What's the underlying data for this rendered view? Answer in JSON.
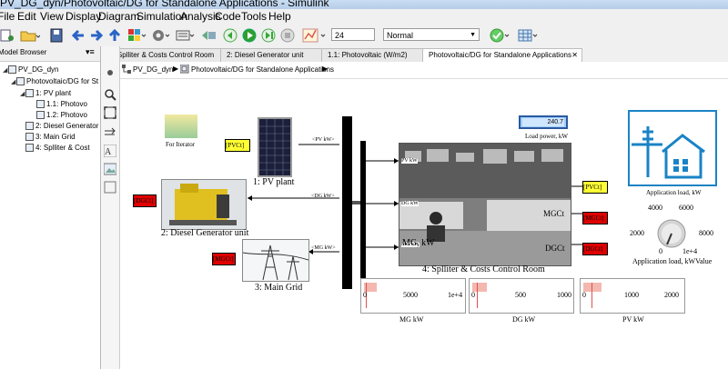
{
  "window_title": "PV_DG_dyn/Photovoltaic/DG for Standalone Applications - Simulink",
  "menu": [
    "File",
    "Edit",
    "View",
    "Display",
    "Diagram",
    "Simulation",
    "Analysis",
    "Code",
    "Tools",
    "Help"
  ],
  "toolbar": {
    "stop_time": "24",
    "sim_mode": "Normal"
  },
  "browser": {
    "title": "Model Browser",
    "items": [
      {
        "label": "PV_DG_dyn"
      },
      {
        "label": "Photovoltaic/DG for St"
      },
      {
        "label": "1: PV plant"
      },
      {
        "label": "1.1: Photovo"
      },
      {
        "label": "1.2: Photovo"
      },
      {
        "label": "2: Diesel Generator"
      },
      {
        "label": "3: Main Grid"
      },
      {
        "label": "4: Splliter & Cost"
      }
    ]
  },
  "tabs": [
    {
      "label": "4: Splliter & Costs Control Room"
    },
    {
      "label": "2: Diesel Generator unit"
    },
    {
      "label": "1.1: Photovoltaic (W/m2)"
    },
    {
      "label": "Photovoltaic/DG for Standalone Applications"
    }
  ],
  "breadcrumb": [
    "PV_DG_dyn",
    "Photovoltaic/DG for Standalone Applications"
  ],
  "diagram": {
    "for_iterator": "For Iterator",
    "pv_plant": "1: PV plant",
    "diesel": "2: Diesel Generator unit",
    "main_grid": "3: Main Grid",
    "control_room": "4: Splliter & Costs Control Room",
    "tag_pvct": "[PVCt]",
    "tag_dgct": "[DGCt]",
    "tag_mgct": "[MGCt]",
    "tag_mgct2": "[MGCt]",
    "tag_dgct2": "[DGCt]",
    "port_pv_kw": "PV kW",
    "port_dg_kw": "DG kW",
    "port_mg_kw": "MG kW",
    "port_pv_in": "<PV kW>",
    "port_dg_in": "<DG kW>",
    "port_mg_in": "<MG kW>",
    "port_mgct": "MGCt",
    "port_dgct": "DGCt",
    "port_mg_k": "MG, kW",
    "load_power_value": "240.7",
    "load_power_label": "Load power, kW",
    "application_load_label": "Application load, kW",
    "knob_label": "Application load, kWValue",
    "knob_ticks": [
      "4000",
      "6000",
      "2000",
      "8000",
      "0",
      "1e+4"
    ],
    "scopes": [
      {
        "label": "MG kW",
        "ticks": [
          "0",
          "5000",
          "1e+4"
        ],
        "level": 0.02
      },
      {
        "label": "DG kW",
        "ticks": [
          "0",
          "500",
          "1000"
        ],
        "level": 0.05
      },
      {
        "label": "PV kW",
        "ticks": [
          "0",
          "1000",
          "2000"
        ],
        "level": 0.08
      }
    ]
  }
}
